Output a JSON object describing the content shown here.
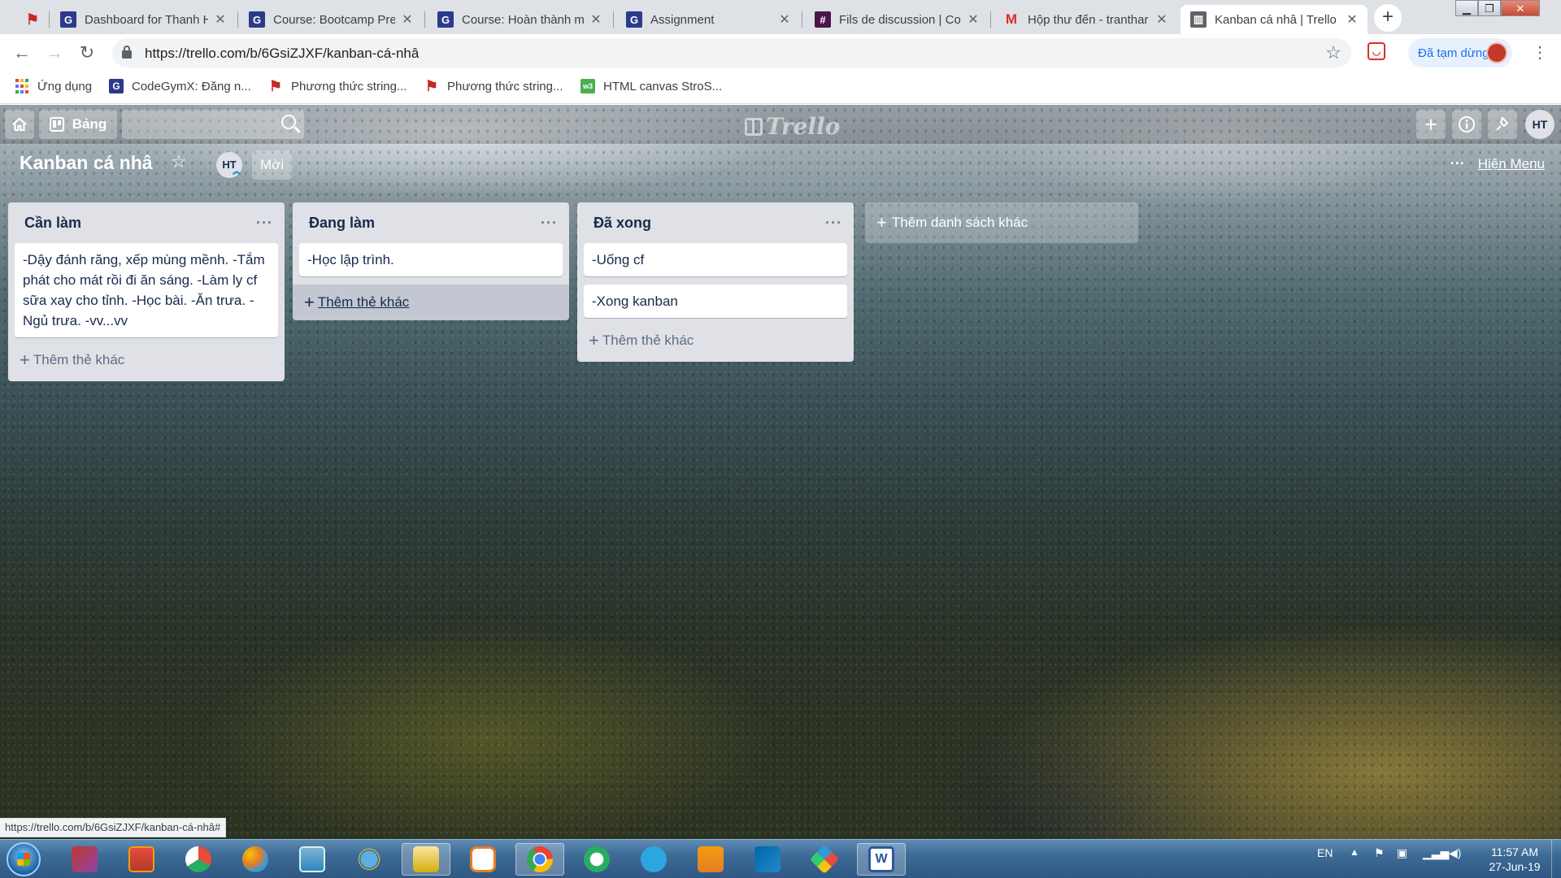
{
  "browser": {
    "tabs": [
      {
        "title": "",
        "favicon": "trello-flag-icon"
      },
      {
        "title": "Dashboard for Thanh H",
        "favicon": "codegym-icon"
      },
      {
        "title": "Course: Bootcamp Prep",
        "favicon": "codegym-icon"
      },
      {
        "title": "Course: Hoàn thành m",
        "favicon": "codegym-icon"
      },
      {
        "title": "Assignment",
        "favicon": "codegym-icon"
      },
      {
        "title": "Fils de discussion | Coc",
        "favicon": "slack-icon"
      },
      {
        "title": "Hộp thư đến - tranthar",
        "favicon": "gmail-icon"
      },
      {
        "title": "Kanban cá nhâ | Trello",
        "favicon": "trello-icon",
        "active": true
      }
    ],
    "url": "https://trello.com/b/6GsiZJXF/kanban-cá-nhâ",
    "profile_status": "Đã tạm dừng",
    "bookmarks": [
      {
        "label": "Ứng dụng",
        "icon": "apps-grid-icon"
      },
      {
        "label": "CodeGymX: Đăng n...",
        "icon": "codegym-icon"
      },
      {
        "label": "Phương thức string...",
        "icon": "flag-icon"
      },
      {
        "label": "Phương thức string...",
        "icon": "flag-icon"
      },
      {
        "label": "HTML canvas StroS...",
        "icon": "w3schools-icon"
      }
    ],
    "status_url": "https://trello.com/b/6GsiZJXF/kanban-cá-nhâ#"
  },
  "trello": {
    "header": {
      "boards_label": "Bảng",
      "logo_text": "Trello",
      "user_initials": "HT"
    },
    "board": {
      "title": "Kanban cá nhâ",
      "member_initials": "HT",
      "invite_label": "Mời",
      "show_menu_label": "Hiện Menu"
    },
    "lists": [
      {
        "title": "Cần làm",
        "cards": [
          "-Dậy đánh răng, xếp mùng mềnh. -Tắm phát cho mát rồi đi ăn sáng. -Làm ly cf sữa xay cho tỉnh. -Học bài. -Ăn trưa. -Ngủ trưa. -vv...vv"
        ],
        "add_card_label": "Thêm thẻ khác"
      },
      {
        "title": "Đang làm",
        "cards": [
          "-Học lập trình."
        ],
        "add_card_label": "Thêm thẻ khác"
      },
      {
        "title": "Đã xong",
        "cards": [
          "-Uống cf",
          "-Xong kanban"
        ],
        "add_card_label": "Thêm thẻ khác"
      }
    ],
    "add_list_label": "Thêm danh sách khác"
  },
  "taskbar": {
    "apps": [
      "winrar-icon",
      "fireworks-icon",
      "app-icon",
      "paint-icon",
      "photo-viewer-icon",
      "internet-explorer-icon",
      "file-explorer-icon",
      "media-player-icon",
      "chrome-icon",
      "greenshot-icon",
      "telegram-icon",
      "sublime-text-icon",
      "vscode-icon",
      "gitkraken-icon",
      "word-icon"
    ],
    "language": "EN",
    "time": "11:57 AM",
    "date": "27-Jun-19"
  }
}
